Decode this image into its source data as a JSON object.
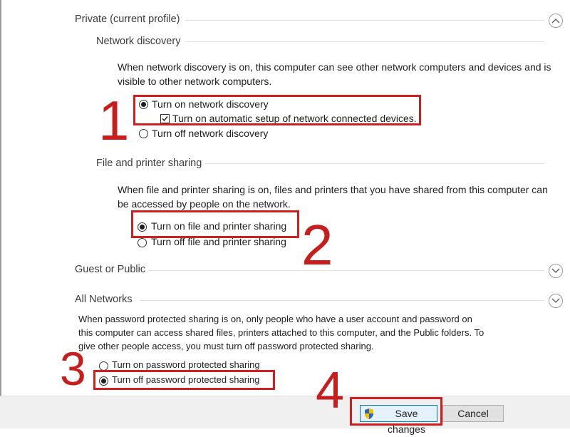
{
  "sections": {
    "private": {
      "title": "Private (current profile)"
    },
    "network_discovery": {
      "title": "Network discovery",
      "description_line1": "When network discovery is on, this computer can see other network computers and devices and is",
      "description_line2": "visible to other network computers.",
      "option_on": "Turn on network discovery",
      "option_auto_setup": "Turn on automatic setup of network connected devices.",
      "option_off": "Turn off network discovery",
      "selected": "on",
      "auto_setup_checked": true
    },
    "file_sharing": {
      "title": "File and printer sharing",
      "description_line1": "When file and printer sharing is on, files and printers that you have shared from this computer can",
      "description_line2": "be accessed by people on the network.",
      "option_on": "Turn on file and printer sharing",
      "option_off": "Turn off file and printer sharing",
      "selected": "on"
    },
    "guest": {
      "title": "Guest or Public"
    },
    "all_networks": {
      "title": "All Networks",
      "description_line1": "When password protected sharing is on, only people who have a user account and password on",
      "description_line2": "this computer can access shared files, printers attached to this computer, and the Public folders. To",
      "description_line3": "give other people access, you must turn off password protected sharing.",
      "option_on": "Turn on password protected sharing",
      "option_off": "Turn off password protected sharing",
      "selected": "off"
    }
  },
  "icons": {
    "chevron_up": "chevron-up-icon",
    "chevron_down": "chevron-down-icon",
    "shield": "uac-shield-icon"
  },
  "footer": {
    "save_label": "Save changes",
    "cancel_label": "Cancel"
  },
  "annotations": {
    "step1": "1",
    "step2": "2",
    "step3": "3",
    "step4": "4",
    "color": "#d11f1f"
  }
}
